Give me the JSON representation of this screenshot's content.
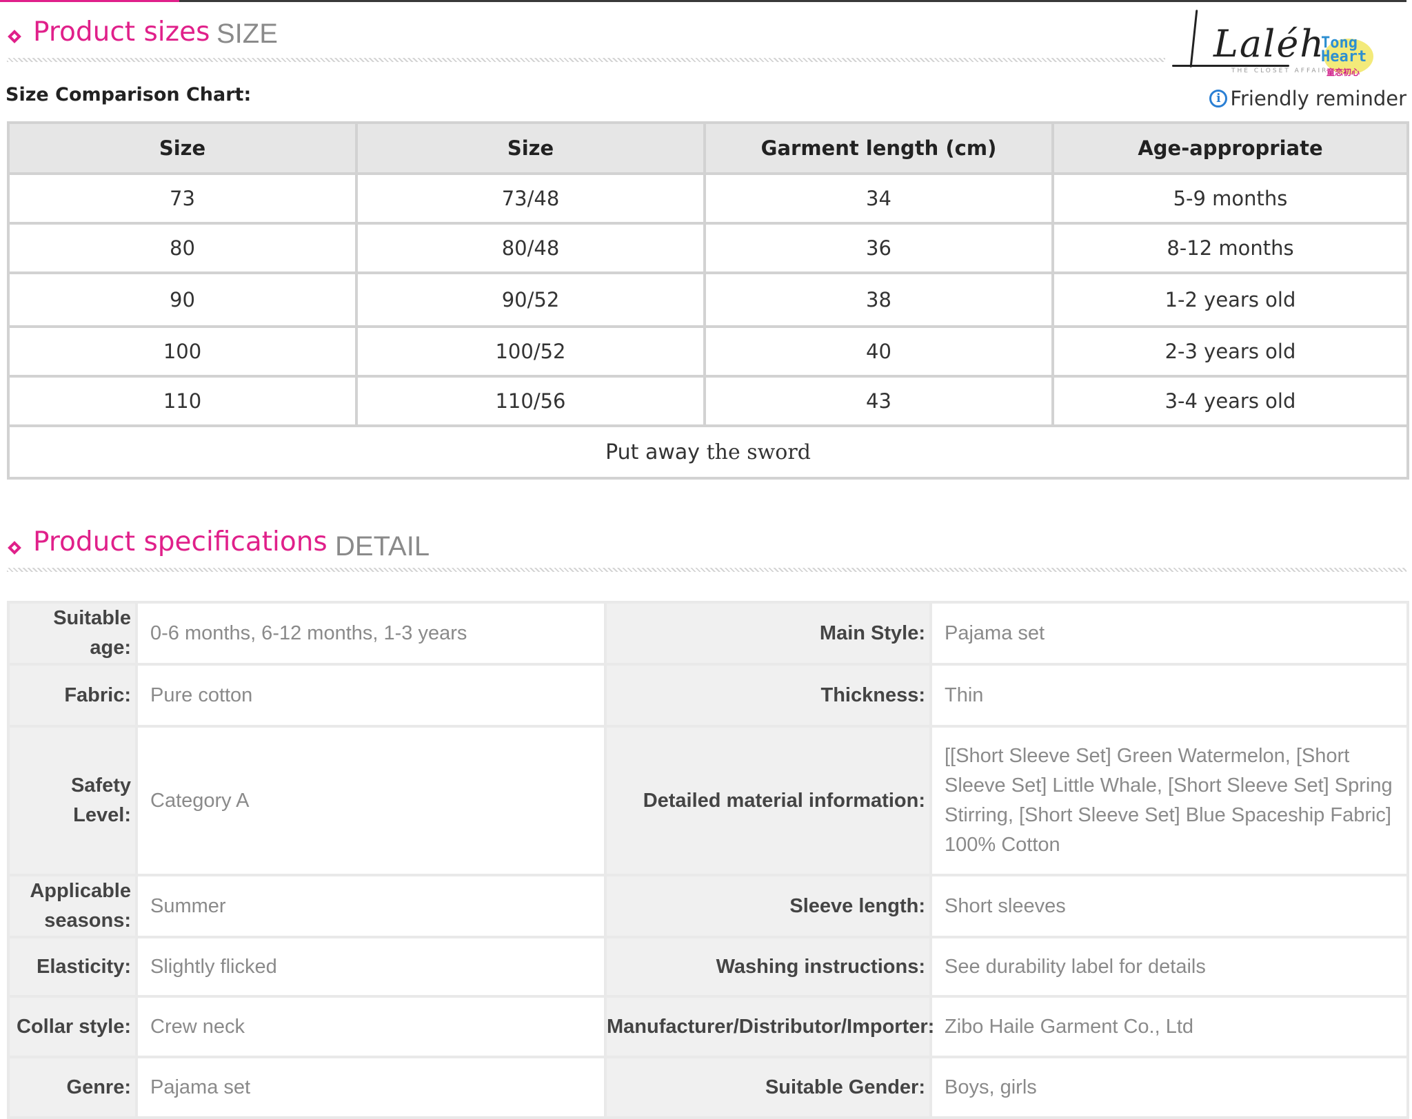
{
  "size_section": {
    "title": "Product sizes",
    "title_en": "SIZE",
    "chart_label": "Size Comparison Chart:",
    "reminder": "Friendly reminder",
    "headers": [
      "Size",
      "Size",
      "Garment length (cm)",
      "Age-appropriate"
    ],
    "rows": [
      [
        "73",
        "73/48",
        "34",
        "5-9 months"
      ],
      [
        "80",
        "80/48",
        "36",
        "8-12 months"
      ],
      [
        "90",
        "90/52",
        "38",
        "1-2 years old"
      ],
      [
        "100",
        "100/52",
        "40",
        "2-3 years old"
      ],
      [
        "110",
        "110/56",
        "43",
        "3-4 years old"
      ]
    ],
    "note_a": "Put away",
    "note_b": "the sword"
  },
  "logo": {
    "signature": "Laléh",
    "tagline": "THE CLOSET AFFAIR",
    "badge_line1": "Tong",
    "badge_line2": "Heart",
    "badge_line3": "童恋初心"
  },
  "spec_section": {
    "title": "Product specifications",
    "title_en": "DETAIL",
    "rows": [
      {
        "l1": "Suitable age:",
        "v1": "0-6 months, 6-12 months, 1-3 years",
        "l2": "Main Style:",
        "v2": "Pajama set"
      },
      {
        "l1": "Fabric:",
        "v1": "Pure cotton",
        "l2": "Thickness:",
        "v2": "Thin"
      },
      {
        "l1": "Safety Level:",
        "v1": "Category A",
        "l2": "Detailed material information:",
        "v2": "[[Short Sleeve Set] Green Watermelon, [Short Sleeve Set] Little Whale, [Short Sleeve Set] Spring Stirring, [Short Sleeve Set] Blue Spaceship Fabric] 100% Cotton"
      },
      {
        "l1": "Applicable seasons:",
        "v1": "Summer",
        "l2": "Sleeve length:",
        "v2": "Short sleeves"
      },
      {
        "l1": "Elasticity:",
        "v1": "Slightly flicked",
        "l2": "Washing instructions:",
        "v2": "See durability label for details"
      },
      {
        "l1": "Collar style:",
        "v1": "Crew neck",
        "l2": "Manufacturer/Distributor/Importer:",
        "v2": "Zibo Haile Garment Co., Ltd"
      },
      {
        "l1": "Genre:",
        "v1": "Pajama set",
        "l2": "Suitable Gender:",
        "v2": "Boys, girls"
      }
    ]
  },
  "colors": {
    "accent": "#e0208a",
    "header_bg": "#e6e6e6",
    "label_bg": "#f0f0f0",
    "value_text": "#8a8a8a"
  }
}
